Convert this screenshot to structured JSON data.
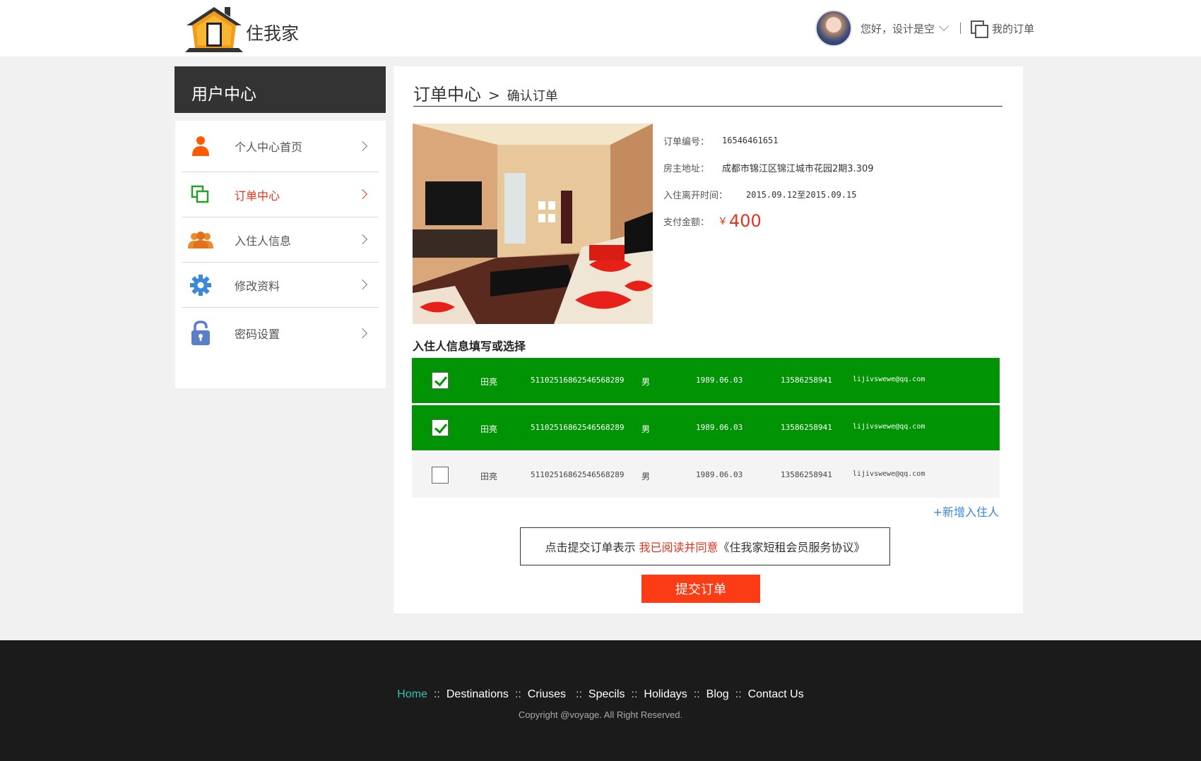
{
  "header": {
    "logo_text": "住我家",
    "greeting": "您好，设计是空",
    "my_orders": "我的订单"
  },
  "sidebar": {
    "title": "用户中心",
    "items": [
      {
        "label": "个人中心首页"
      },
      {
        "label": "订单中心"
      },
      {
        "label": "入住人信息"
      },
      {
        "label": "修改资料"
      },
      {
        "label": "密码设置"
      }
    ]
  },
  "breadcrumb": {
    "section": "订单中心",
    "separator": ">",
    "page": "确认订单"
  },
  "order": {
    "number_label": "订单编号：",
    "number": "16546461651",
    "address_label": "房主地址：",
    "address": "成都市锦江区锦江城市花园2期3.309",
    "stay_label": "入住离开时间：",
    "stay": "2015.09.12至2015.09.15",
    "pay_label": "支付金额：",
    "currency": "￥",
    "amount": "400"
  },
  "guests": {
    "title": "入住人信息填写或选择",
    "rows": [
      {
        "checked": true,
        "name": "田亮",
        "id": "51102516862546568289",
        "sex": "男",
        "birth": "1989.06.03",
        "phone": "13586258941",
        "email": "lijivswewe@qq.com"
      },
      {
        "checked": true,
        "name": "田亮",
        "id": "51102516862546568289",
        "sex": "男",
        "birth": "1989.06.03",
        "phone": "13586258941",
        "email": "lijivswewe@qq.com"
      },
      {
        "checked": false,
        "name": "田亮",
        "id": "51102516862546568289",
        "sex": "男",
        "birth": "1989.06.03",
        "phone": "13586258941",
        "email": "lijivswewe@qq.com"
      }
    ],
    "add_label": "+新增入住人"
  },
  "agreement": {
    "prefix": "点击提交订单表示 ",
    "highlight": "我已阅读并同意",
    "suffix": "《住我家短租会员服务协议》"
  },
  "submit_label": "提交订单",
  "footer": {
    "nav": [
      {
        "label": "Home"
      },
      {
        "label": "Destinations"
      },
      {
        "label": "Criuses"
      },
      {
        "label": "Specils"
      },
      {
        "label": "Holidays"
      },
      {
        "label": "Blog"
      },
      {
        "label": "Contact Us"
      }
    ],
    "separator": "::",
    "copyright": "Copyright @voyage. All Right Reserved."
  },
  "colors": {
    "accent_red": "#e8321c",
    "selected_green": "#009404",
    "link_blue": "#3a86d8",
    "footer_active": "#2ec4b6"
  }
}
